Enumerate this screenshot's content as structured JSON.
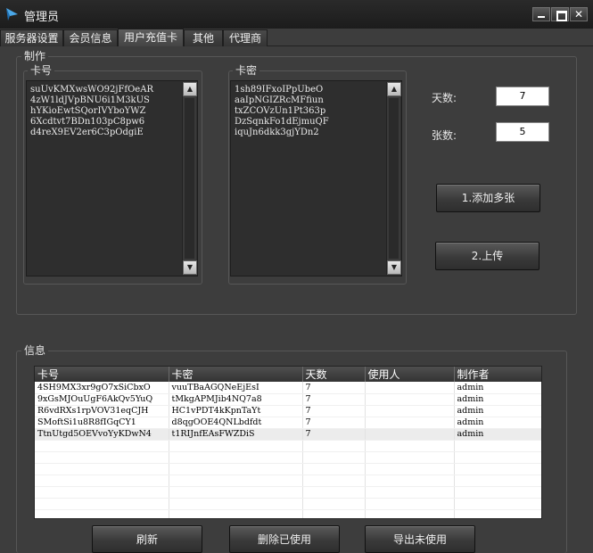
{
  "window": {
    "title": "管理员"
  },
  "tabs": [
    {
      "label": "服务器设置"
    },
    {
      "label": "会员信息"
    },
    {
      "label": "用户充值卡",
      "active": true
    },
    {
      "label": "其他"
    },
    {
      "label": "代理商"
    }
  ],
  "make": {
    "group_label": "制作",
    "card_no": {
      "label": "卡号",
      "lines": [
        "suUvKMXwsWO92jFfOeAR",
        "4zW1ldJVpBNU6i1M3kUS",
        "hYKioEwtSQorIVYboYWZ",
        "6Xcdtvt7BDn103pC8pw6",
        "d4reX9EV2er6C3pOdgiE"
      ]
    },
    "card_pwd": {
      "label": "卡密",
      "lines": [
        "1sh89IFxoIPpUbeO",
        "aaIpNGIZRcMFfiun",
        "txZCOVzUn1Pt363p",
        "DzSqnkFo1dEjmuQF",
        "iquJn6dkk3gjYDn2"
      ]
    },
    "days_label": "天数:",
    "days_value": "7",
    "count_label": "张数:",
    "count_value": "5",
    "add_button": "1.添加多张",
    "upload_button": "2.上传"
  },
  "info": {
    "group_label": "信息",
    "columns": [
      "卡号",
      "卡密",
      "天数",
      "使用人",
      "制作者"
    ],
    "rows": [
      [
        "4SH9MX3xr9gO7xSiCbxO",
        "vuuTBaAGQNeEjEsI",
        "7",
        "",
        "admin"
      ],
      [
        "9xGsMJOuUgF6AkQv5YuQ",
        "tMkgAPMJib4NQ7a8",
        "7",
        "",
        "admin"
      ],
      [
        "R6vdRXs1rpVOV31eqCJH",
        "HC1vPDT4kKpnTaYt",
        "7",
        "",
        "admin"
      ],
      [
        "SMoftSi1u8R8fIGqCY1",
        "d8qgOOE4QNLbdfdt",
        "7",
        "",
        "admin"
      ],
      [
        "TtnUtgd5OEVvoYyKDwN4",
        "t1RIJnfEAsFWZDiS",
        "7",
        "",
        "admin"
      ]
    ],
    "refresh_button": "刷新",
    "delete_used_button": "删除已使用",
    "export_unused_button": "导出未使用"
  }
}
